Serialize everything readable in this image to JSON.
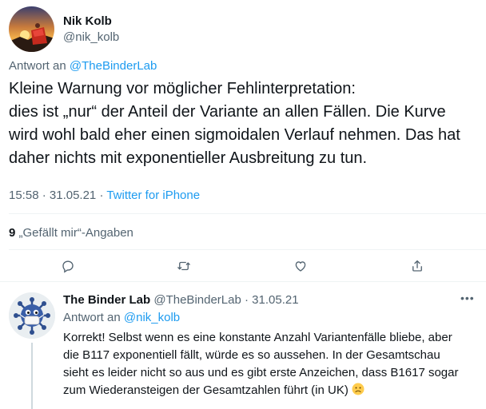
{
  "main_tweet": {
    "author_name": "Nik Kolb",
    "author_handle": "@nik_kolb",
    "reply_prefix": "Antwort an",
    "reply_target": "@TheBinderLab",
    "text_lines": [
      "Kleine Warnung vor möglicher Fehlinterpretation:",
      "dies ist „nur“ der Anteil der Variante an allen Fällen. Die Kurve",
      "wird wohl bald eher einen sigmoidalen Verlauf nehmen. Das hat",
      "daher nichts mit exponentieller Ausbreitung zu tun."
    ],
    "time": "15:58",
    "date": "31.05.21",
    "meta_separator": " · ",
    "source": "Twitter for iPhone",
    "likes_count": "9",
    "likes_label": "„Gefällt mir“-Angaben",
    "icons": [
      "reply-icon",
      "retweet-icon",
      "like-icon",
      "share-icon"
    ]
  },
  "reply_tweet": {
    "author_name": "The Binder Lab",
    "author_handle": "@TheBinderLab",
    "separator": " · ",
    "date": "31.05.21",
    "reply_prefix": "Antwort an",
    "reply_target": "@nik_kolb",
    "text_lines": [
      "Korrekt! Selbst wenn es eine konstante Anzahl Variantenfälle bliebe, aber",
      "die B117 exponentiell fällt, würde es so aussehen. In der Gesamtschau",
      "sieht es leider nicht so aus und es gibt erste Anzeichen, dass B1617 sogar",
      "zum Wiederansteigen der Gesamtzahlen führt (in UK)"
    ],
    "emoji": "slightly-frowning-face"
  },
  "colors": {
    "link": "#1d9bf0",
    "secondary_text": "#536471",
    "primary_text": "#0f1419",
    "divider": "#eff3f4"
  }
}
